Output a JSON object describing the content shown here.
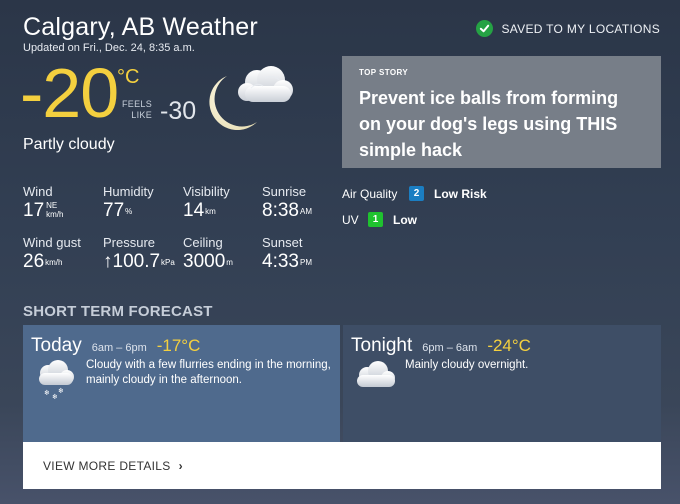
{
  "header": {
    "title": "Calgary, AB Weather",
    "updated": "Updated on Fri., Dec. 24, 8:35 a.m.",
    "saved_label": "SAVED TO MY LOCATIONS"
  },
  "current": {
    "temp": "-20",
    "unit": "°C",
    "feels_label_1": "FEELS",
    "feels_label_2": "LIKE",
    "feels_value": "-30",
    "condition": "Partly cloudy",
    "icon": "moon-cloud-icon"
  },
  "stats": {
    "wind": {
      "label": "Wind",
      "value": "17",
      "dir": "NE",
      "unit": "km/h"
    },
    "humidity": {
      "label": "Humidity",
      "value": "77",
      "unit": "%"
    },
    "visibility": {
      "label": "Visibility",
      "value": "14",
      "unit": "km"
    },
    "sunrise": {
      "label": "Sunrise",
      "value": "8:38",
      "unit": "AM"
    },
    "wind_gust": {
      "label": "Wind gust",
      "value": "26",
      "unit": "km/h"
    },
    "pressure": {
      "label": "Pressure",
      "arrow": "↑",
      "value": "100.7",
      "unit": "kPa"
    },
    "ceiling": {
      "label": "Ceiling",
      "value": "3000",
      "unit": "m"
    },
    "sunset": {
      "label": "Sunset",
      "value": "4:33",
      "unit": "PM"
    }
  },
  "top_story": {
    "tag": "TOP STORY",
    "headline": "Prevent ice balls from forming on your dog's legs using THIS simple hack"
  },
  "air_quality": {
    "label": "Air Quality",
    "index": "2",
    "risk": "Low Risk",
    "color": "#1b7ec2"
  },
  "uv": {
    "label": "UV",
    "index": "1",
    "risk": "Low",
    "color": "#1fc22f"
  },
  "short_term": {
    "title": "SHORT TERM FORECAST",
    "today": {
      "name": "Today",
      "time": "6am – 6pm",
      "temp": "-17°C",
      "desc": "Cloudy with a few flurries ending in the morning, mainly cloudy in the afternoon.",
      "icon": "cloud-snow-icon"
    },
    "tonight": {
      "name": "Tonight",
      "time": "6pm – 6am",
      "temp": "-24°C",
      "desc": "Mainly cloudy overnight.",
      "icon": "cloud-icon"
    },
    "details_label": "VIEW MORE DETAILS"
  },
  "colors": {
    "accent_yellow": "#f4d03f",
    "today_card": "#4f6a8d",
    "tonight_card": "#3e4e66"
  }
}
